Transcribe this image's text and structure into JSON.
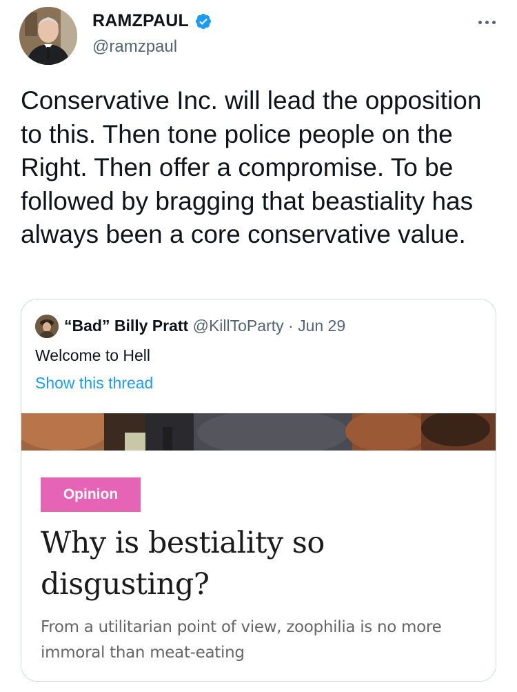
{
  "author": {
    "display_name": "RAMZPAUL",
    "handle": "@ramzpaul",
    "verified": true,
    "avatar_icon": "profile-photo"
  },
  "tweet": {
    "text": "Conservative Inc. will lead the opposition to this. Then tone police people on the Right. Then offer a compromise. To be followed by bragging that beastiality has always been a core conservative value."
  },
  "quoted_tweet": {
    "display_name": "“Bad” Billy Pratt",
    "handle": "@KillToParty",
    "separator": "·",
    "date": "Jun 29",
    "text": "Welcome to Hell",
    "show_thread": "Show this thread",
    "article": {
      "tag": "Opinion",
      "headline": "Why is bestiality so disgusting?",
      "dek": "From a utilitarian point of view, zoophilia is no more immoral than meat-eating"
    }
  },
  "colors": {
    "link": "#1d9bf0",
    "verified": "#1d9bf0",
    "opinion_tag": "#e564b5",
    "secondary_text": "#536471"
  }
}
